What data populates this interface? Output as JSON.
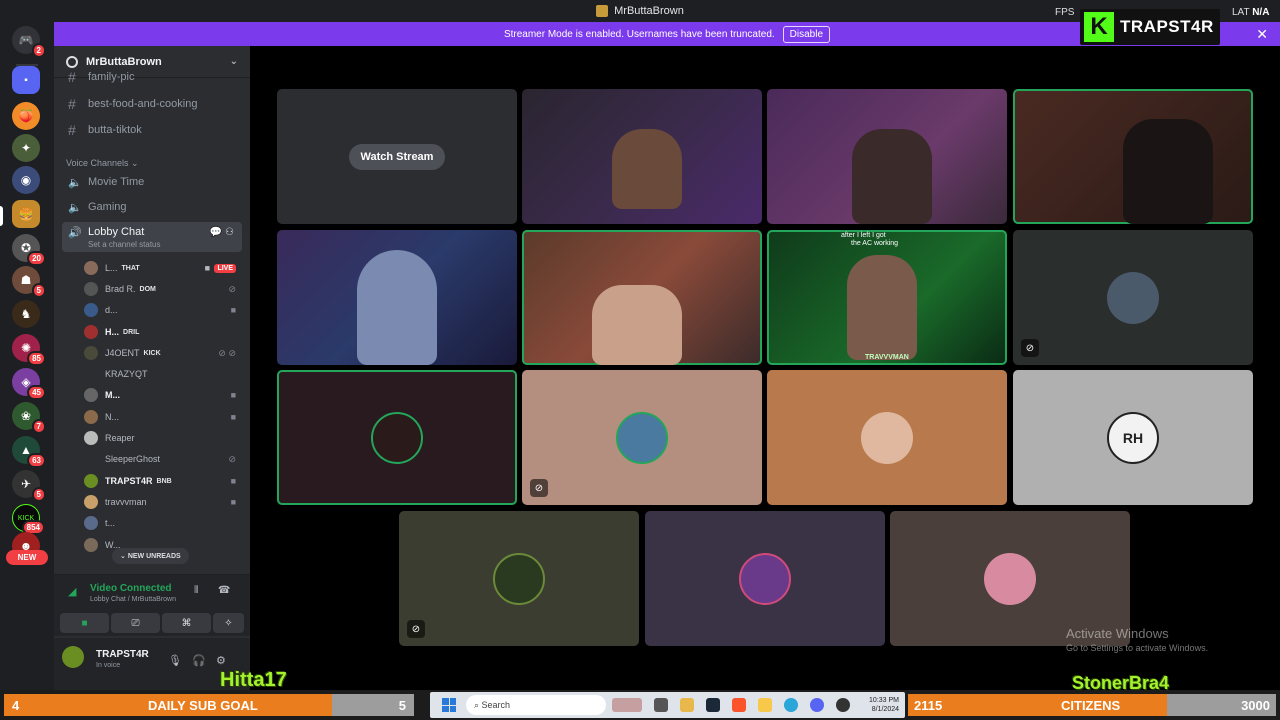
{
  "window": {
    "title": "MrButtaBrown",
    "fps_label": "FPS",
    "lat_label": "LAT",
    "lat_value": "N/A"
  },
  "banner": {
    "text": "Streamer Mode is enabled. Usernames have been truncated.",
    "disable_label": "Disable",
    "close_icon": "close-icon"
  },
  "kick_overlay": {
    "logo_letter": "K",
    "name": "TRAPST4R",
    "color": "#53fc18"
  },
  "server_rail": {
    "home_badge": "2",
    "badges": [
      "20",
      "5",
      "85",
      "45",
      "7",
      "63",
      "5",
      "854"
    ],
    "new_label": "NEW"
  },
  "sidebar": {
    "server_name": "MrButtaBrown",
    "text_channels": [
      "family-pic",
      "best-food-and-cooking",
      "butta-tiktok"
    ],
    "voice_header": "Voice Channels",
    "voice_channels": [
      "Movie Time",
      "Gaming"
    ],
    "active_channel": {
      "name": "Lobby Chat",
      "status": "Set a channel status"
    },
    "members": [
      {
        "name": "L...",
        "tag": "THAT",
        "live": "LIVE"
      },
      {
        "name": "Brad R.",
        "tag": "DOM"
      },
      {
        "name": "d..."
      },
      {
        "name": "H...",
        "tag": "DRIL"
      },
      {
        "name": "J4OENT",
        "tag": "KICK"
      },
      {
        "name": "KRAZYQT"
      },
      {
        "name": "M..."
      },
      {
        "name": "N..."
      },
      {
        "name": "Reaper"
      },
      {
        "name": "SleeperGhost"
      },
      {
        "name": "TRAPST4R",
        "tag": "BNB"
      },
      {
        "name": "travvvman"
      },
      {
        "name": "t..."
      },
      {
        "name": "W..."
      }
    ],
    "new_unreads": "NEW UNREADS"
  },
  "voice": {
    "status": "Video Connected",
    "location": "Lobby Chat / MrButtaBrown"
  },
  "user": {
    "name": "TRAPST4R",
    "status": "In voice"
  },
  "grid": {
    "watch_stream": "Watch Stream",
    "video_caption_1": "after I left I got",
    "video_caption_2": "the AC working",
    "video_tag": "TRAVVVMAN",
    "avatar_initials": "RH"
  },
  "activation": {
    "title": "Activate Windows",
    "subtitle": "Go to Settings to activate Windows."
  },
  "overlay": {
    "left_name": "Hitta17",
    "right_name": "StonerBra4"
  },
  "sub_goal": {
    "current": "4",
    "label": "DAILY SUB GOAL",
    "target": "5",
    "progress": 0.8
  },
  "citizens_goal": {
    "current": "2115",
    "label": "CITIZENS",
    "target": "3000",
    "progress": 0.705
  },
  "taskbar": {
    "search_placeholder": "Search",
    "time": "10:33 PM",
    "date": "8/1/2024"
  }
}
